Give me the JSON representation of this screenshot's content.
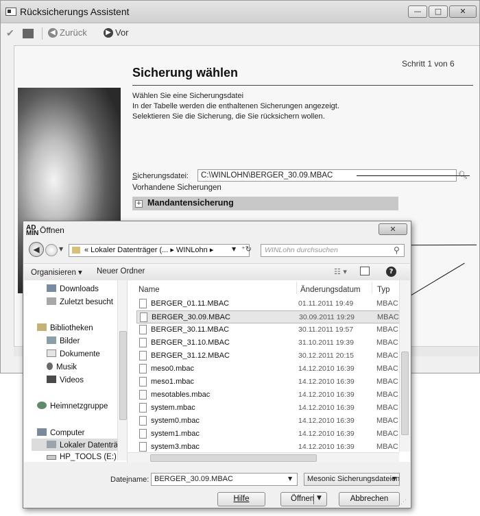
{
  "wizard": {
    "title": "Rücksicherungs Assistent",
    "window_buttons": {
      "minimize": "—",
      "maximize": "□",
      "close": "✕"
    },
    "toolbar": {
      "check_icon": "✔",
      "back_label": "Zurück",
      "next_label": "Vor"
    },
    "step": "Schritt  1 von 6",
    "heading": "Sicherung wählen",
    "description": [
      "Wählen Sie eine Sicherungsdatei",
      "In der Tabelle werden die enthaltenen Sicherungen angezeigt.",
      "Selektieren Sie die Sicherung, die Sie rücksichern wollen."
    ],
    "file_label": "Sicherungsdatei:",
    "file_value": "C:\\WINLOHN\\BERGER_30.09.MBAC",
    "existing_label": "Vorhandene Sicherungen",
    "tree": {
      "expander": "+",
      "label": "Mandantensicherung"
    }
  },
  "dialog": {
    "title_icon": "AD MIN",
    "title": "Öffnen",
    "close": "✕",
    "address": "« Lokaler Datenträger (... ▸ WINLohn ▸",
    "search_placeholder": "WINLohn durchsuchen",
    "organize_label": "Organisieren ▾",
    "new_folder_label": "Neuer Ordner",
    "nav": [
      {
        "label": "Downloads"
      },
      {
        "label": "Zuletzt besucht"
      },
      {
        "label": "Bibliotheken"
      },
      {
        "label": "Bilder"
      },
      {
        "label": "Dokumente"
      },
      {
        "label": "Musik"
      },
      {
        "label": "Videos"
      },
      {
        "label": "Heimnetzgruppe"
      },
      {
        "label": "Computer"
      },
      {
        "label": "Lokaler Datenträg"
      },
      {
        "label": "HP_TOOLS (E:)"
      }
    ],
    "columns": {
      "name": "Name",
      "date": "Änderungsdatum",
      "type": "Typ"
    },
    "files": [
      {
        "name": "BERGER_01.11.MBAC",
        "date": "01.11.2011 19:49",
        "type": "MBAC"
      },
      {
        "name": "BERGER_30.09.MBAC",
        "date": "30.09.2011 19:29",
        "type": "MBAC"
      },
      {
        "name": "BERGER_30.11.MBAC",
        "date": "30.11.2011 19:57",
        "type": "MBAC"
      },
      {
        "name": "BERGER_31.10.MBAC",
        "date": "31.10.2011 19:39",
        "type": "MBAC"
      },
      {
        "name": "BERGER_31.12.MBAC",
        "date": "30.12.2011 20:15",
        "type": "MBAC"
      },
      {
        "name": "meso0.mbac",
        "date": "14.12.2010 16:39",
        "type": "MBAC"
      },
      {
        "name": "meso1.mbac",
        "date": "14.12.2010 16:39",
        "type": "MBAC"
      },
      {
        "name": "mesotables.mbac",
        "date": "14.12.2010 16:39",
        "type": "MBAC"
      },
      {
        "name": "system.mbac",
        "date": "14.12.2010 16:39",
        "type": "MBAC"
      },
      {
        "name": "system0.mbac",
        "date": "14.12.2010 16:39",
        "type": "MBAC"
      },
      {
        "name": "system1.mbac",
        "date": "14.12.2010 16:39",
        "type": "MBAC"
      },
      {
        "name": "system3.mbac",
        "date": "14.12.2010 16:39",
        "type": "MBAC"
      }
    ],
    "selected_file": "BERGER_30.09.MBAC",
    "filename_label_pre": "Date",
    "filename_label_u": "i",
    "filename_label_post": "name:",
    "filename_value": "BERGER_30.09.MBAC",
    "filetype_value": "Mesonic Sicherungsdateien (*.MBAC)",
    "help_button": "Hilfe",
    "open_button": "Öffnen",
    "cancel_button": "Abbrechen"
  }
}
